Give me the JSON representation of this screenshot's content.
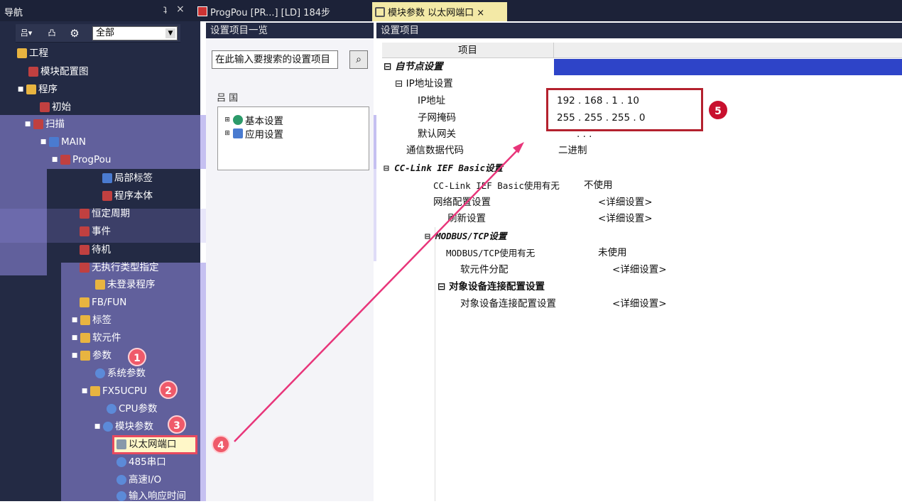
{
  "topbar": {
    "nav_title": "导航",
    "pin": "ʇ",
    "close": "×",
    "tab_progpou": "ProgPou [PR...] [LD] 184步",
    "tab_module": "模块参数 以太网端口 ×"
  },
  "nav_toolbar": {
    "btn1": "吕▾",
    "btn2": "凸",
    "btn3": "⚙",
    "filter_value": "全部"
  },
  "nav_tree": [
    {
      "label": "工程"
    },
    {
      "label": "模块配置图"
    },
    {
      "label": "程序"
    },
    {
      "label": "初始"
    },
    {
      "label": "扫描"
    },
    {
      "label": "MAIN"
    },
    {
      "label": "ProgPou"
    },
    {
      "label": "局部标签"
    },
    {
      "label": "程序本体"
    },
    {
      "label": "恒定周期"
    },
    {
      "label": "事件"
    },
    {
      "label": "待机"
    },
    {
      "label": "无执行类型指定"
    },
    {
      "label": "未登录程序"
    },
    {
      "label": "FB/FUN"
    },
    {
      "label": "标签"
    },
    {
      "label": "软元件"
    },
    {
      "label": "参数"
    },
    {
      "label": "系统参数"
    },
    {
      "label": "FX5UCPU"
    },
    {
      "label": "CPU参数"
    },
    {
      "label": "模块参数"
    },
    {
      "label": "以太网端口"
    },
    {
      "label": "485串口"
    },
    {
      "label": "高速I/O"
    },
    {
      "label": "输入响应时间"
    }
  ],
  "list_pane": {
    "header": "设置项目一览",
    "search_placeholder": "在此输入要搜索的设置项目",
    "tools": "吕 国",
    "items": [
      {
        "label": "基本设置"
      },
      {
        "label": "应用设置"
      }
    ]
  },
  "detail_pane": {
    "header": "设置项目",
    "col_item": "项目",
    "rows": [
      {
        "label": "自节点设置",
        "value": ""
      },
      {
        "label": "IP地址设置",
        "value": ""
      },
      {
        "label": "IP地址",
        "value": "192 . 168 .   1 .  10"
      },
      {
        "label": "子网掩码",
        "value": "255 . 255 . 255 .   0"
      },
      {
        "label": "默认网关",
        "value": ".       .       ."
      },
      {
        "label": "通信数据代码",
        "value": "二进制"
      },
      {
        "label": "CC-Link IEF Basic设置",
        "value": ""
      },
      {
        "label": "CC-Link IEF Basic使用有无",
        "value": "不使用"
      },
      {
        "label": "网络配置设置",
        "value": "<详细设置>"
      },
      {
        "label": "刷新设置",
        "value": "<详细设置>"
      },
      {
        "label": "MODBUS/TCP设置",
        "value": ""
      },
      {
        "label": "MODBUS/TCP使用有无",
        "value": "未使用"
      },
      {
        "label": "软元件分配",
        "value": "<详细设置>"
      },
      {
        "label": "对象设备连接配置设置",
        "value": ""
      },
      {
        "label": "对象设备连接配置设置",
        "value": "<详细设置>"
      }
    ]
  },
  "badges": {
    "b1": "1",
    "b2": "2",
    "b3": "3",
    "b4": "4",
    "b5": "5"
  },
  "colors": {
    "nav_bg": "#232a44",
    "highlight": "#fff7c8",
    "annotation": "#e84a5f",
    "arrow": "#e8357a"
  }
}
